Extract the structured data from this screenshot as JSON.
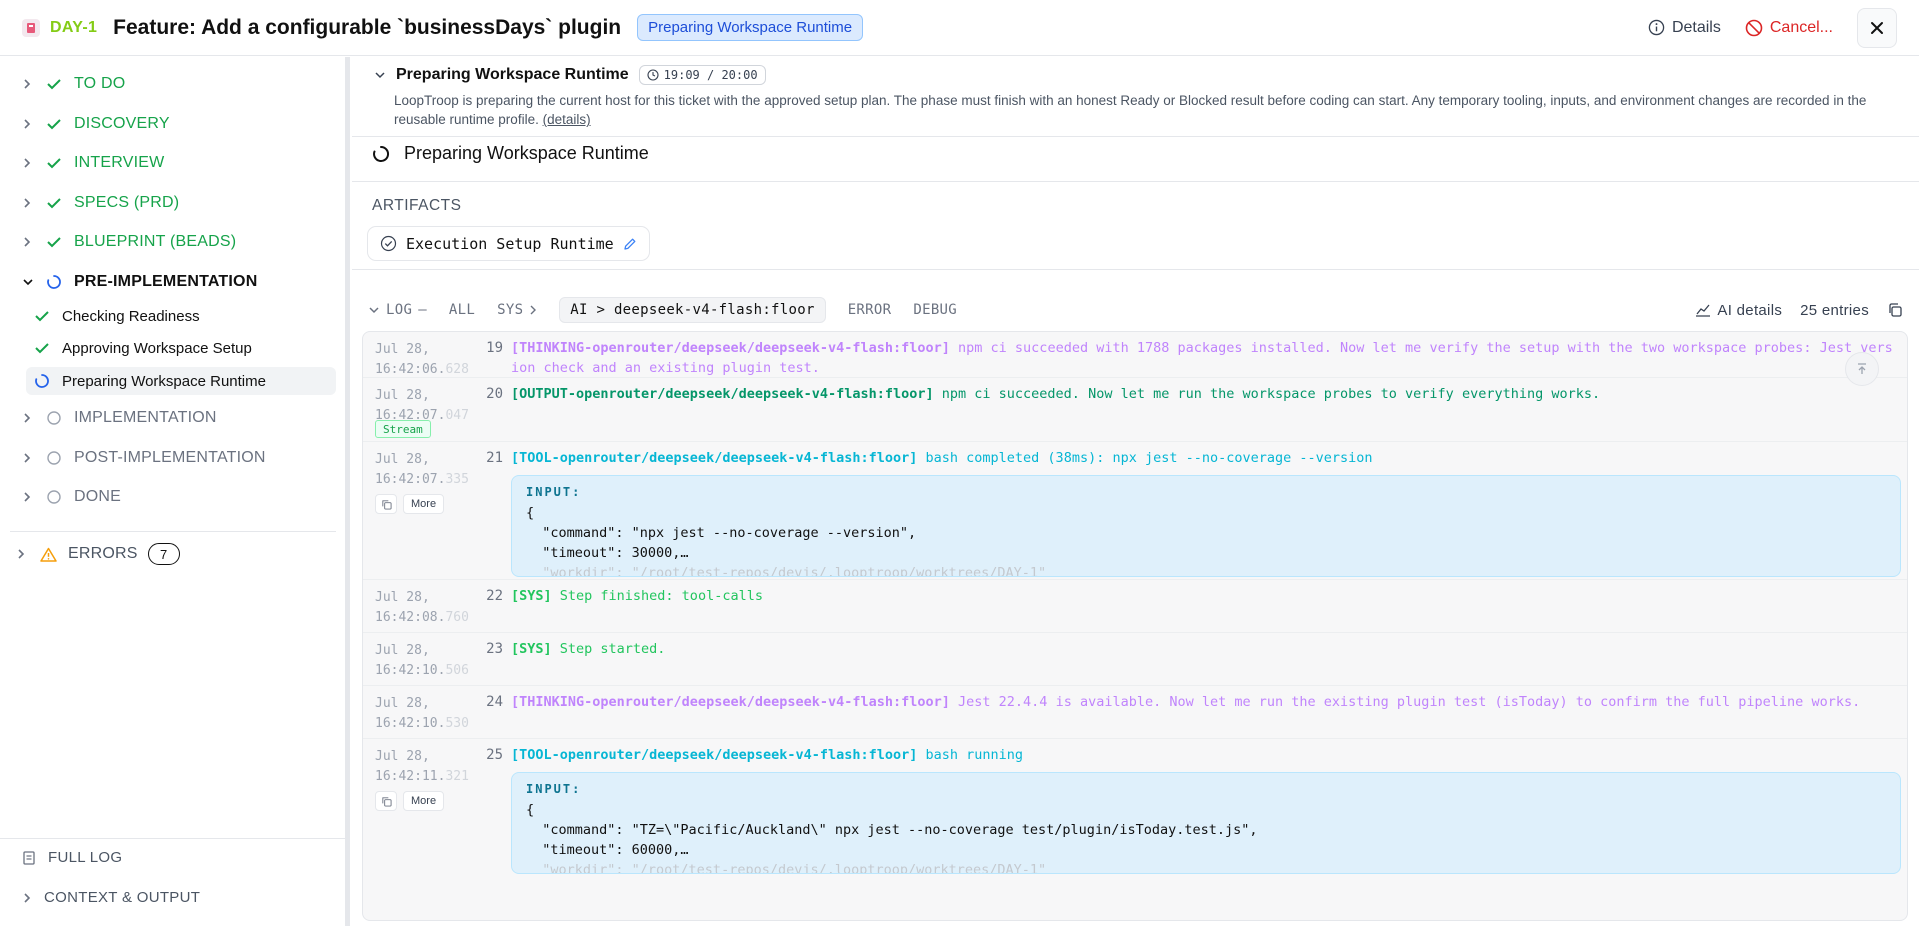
{
  "header": {
    "ticket_id": "DAY-1",
    "title": "Feature: Add a configurable `businessDays` plugin",
    "status_badge": "Preparing Workspace Runtime",
    "details_label": "Details",
    "cancel_label": "Cancel..."
  },
  "sidebar": {
    "phases_top": [
      {
        "label": "TO DO",
        "status": "done"
      },
      {
        "label": "DISCOVERY",
        "status": "done"
      },
      {
        "label": "INTERVIEW",
        "status": "done"
      },
      {
        "label": "SPECS (PRD)",
        "status": "done"
      },
      {
        "label": "BLUEPRINT (BEADS)",
        "status": "done"
      }
    ],
    "active_phase": {
      "label": "PRE-IMPLEMENTATION",
      "status": "running"
    },
    "sub_steps": [
      {
        "label": "Checking Readiness",
        "status": "done"
      },
      {
        "label": "Approving Workspace Setup",
        "status": "done"
      },
      {
        "label": "Preparing Workspace Runtime",
        "status": "running"
      }
    ],
    "phases_bottom": [
      {
        "label": "IMPLEMENTATION",
        "status": "pending"
      },
      {
        "label": "POST-IMPLEMENTATION",
        "status": "pending"
      },
      {
        "label": "DONE",
        "status": "pending"
      }
    ],
    "errors": {
      "label": "ERRORS",
      "count": "7"
    },
    "full_log_label": "FULL LOG",
    "context_label": "CONTEXT & OUTPUT"
  },
  "phase": {
    "title": "Preparing Workspace Runtime",
    "timer": "19:09 / 20:00",
    "description": "LoopTroop is preparing the current host for this ticket with the approved setup plan. The phase must finish with an honest Ready or Blocked result before coding can start. Any temporary tooling, inputs, and environment changes are recorded in the reusable runtime profile.",
    "details_link": "(details)",
    "running_label": "Preparing Workspace Runtime"
  },
  "artifacts": {
    "label": "ARTIFACTS",
    "items": [
      {
        "label": "Execution Setup Runtime"
      }
    ]
  },
  "log": {
    "label": "LOG",
    "dash": "—",
    "filters": {
      "all": "ALL",
      "sys": "SYS",
      "ai": "AI > deepseek-v4-flash:floor",
      "error": "ERROR",
      "debug": "DEBUG"
    },
    "ai_details": "AI details",
    "entries_count": "25 entries",
    "stream_label": "Stream",
    "more_label": "More",
    "input_label": "INPUT:",
    "entries": [
      {
        "date": "Jul 28,",
        "time": "16:42:06.",
        "ms": "628",
        "num": "19",
        "tag": "[THINKING-openrouter/deepseek/deepseek-v4-flash:floor]",
        "msg": " npm ci succeeded with 1788 packages installed. Now let me verify the setup with the two workspace probes: Jest version check and an existing plugin test."
      },
      {
        "date": "Jul 28,",
        "time": "16:42:07.",
        "ms": "047",
        "num": "20",
        "tag": "[OUTPUT-openrouter/deepseek/deepseek-v4-flash:floor]",
        "msg": " npm ci succeeded. Now let me run the workspace probes to verify everything works."
      },
      {
        "date": "Jul 28,",
        "time": "16:42:07.",
        "ms": "335",
        "num": "21",
        "tag": "[TOOL-openrouter/deepseek/deepseek-v4-flash:floor]",
        "msg": " bash completed (38ms): npx jest --no-coverage --version",
        "input": [
          "{",
          "  \"command\": \"npx jest --no-coverage --version\",",
          "  \"timeout\": 30000,…",
          "  \"workdir\": \"/root/test-repos/devjs/.looptroop/worktrees/DAY-1\""
        ]
      },
      {
        "date": "Jul 28,",
        "time": "16:42:08.",
        "ms": "760",
        "num": "22",
        "tag": "[SYS]",
        "msg": " Step finished: tool-calls"
      },
      {
        "date": "Jul 28,",
        "time": "16:42:10.",
        "ms": "506",
        "num": "23",
        "tag": "[SYS]",
        "msg": " Step started."
      },
      {
        "date": "Jul 28,",
        "time": "16:42:10.",
        "ms": "530",
        "num": "24",
        "tag": "[THINKING-openrouter/deepseek/deepseek-v4-flash:floor]",
        "msg": " Jest 22.4.4 is available. Now let me run the existing plugin test (isToday) to confirm the full pipeline works."
      },
      {
        "date": "Jul 28,",
        "time": "16:42:11.",
        "ms": "321",
        "num": "25",
        "tag": "[TOOL-openrouter/deepseek/deepseek-v4-flash:floor]",
        "msg": " bash running",
        "input": [
          "{",
          "  \"command\": \"TZ=\\\"Pacific/Auckland\\\" npx jest --no-coverage test/plugin/isToday.test.js\",",
          "  \"timeout\": 60000,…",
          "  \"workdir\": \"/root/test-repos/devjs/.looptroop/worktrees/DAY-1\""
        ]
      }
    ]
  },
  "colors": {
    "done": "#16a34a",
    "running": "#2563eb",
    "thinking": "#c084fc",
    "output": "#059669",
    "tool": "#06b6d4",
    "sys": "#22c55e",
    "cancel": "#dc2626",
    "ticket": "#84cc16"
  }
}
